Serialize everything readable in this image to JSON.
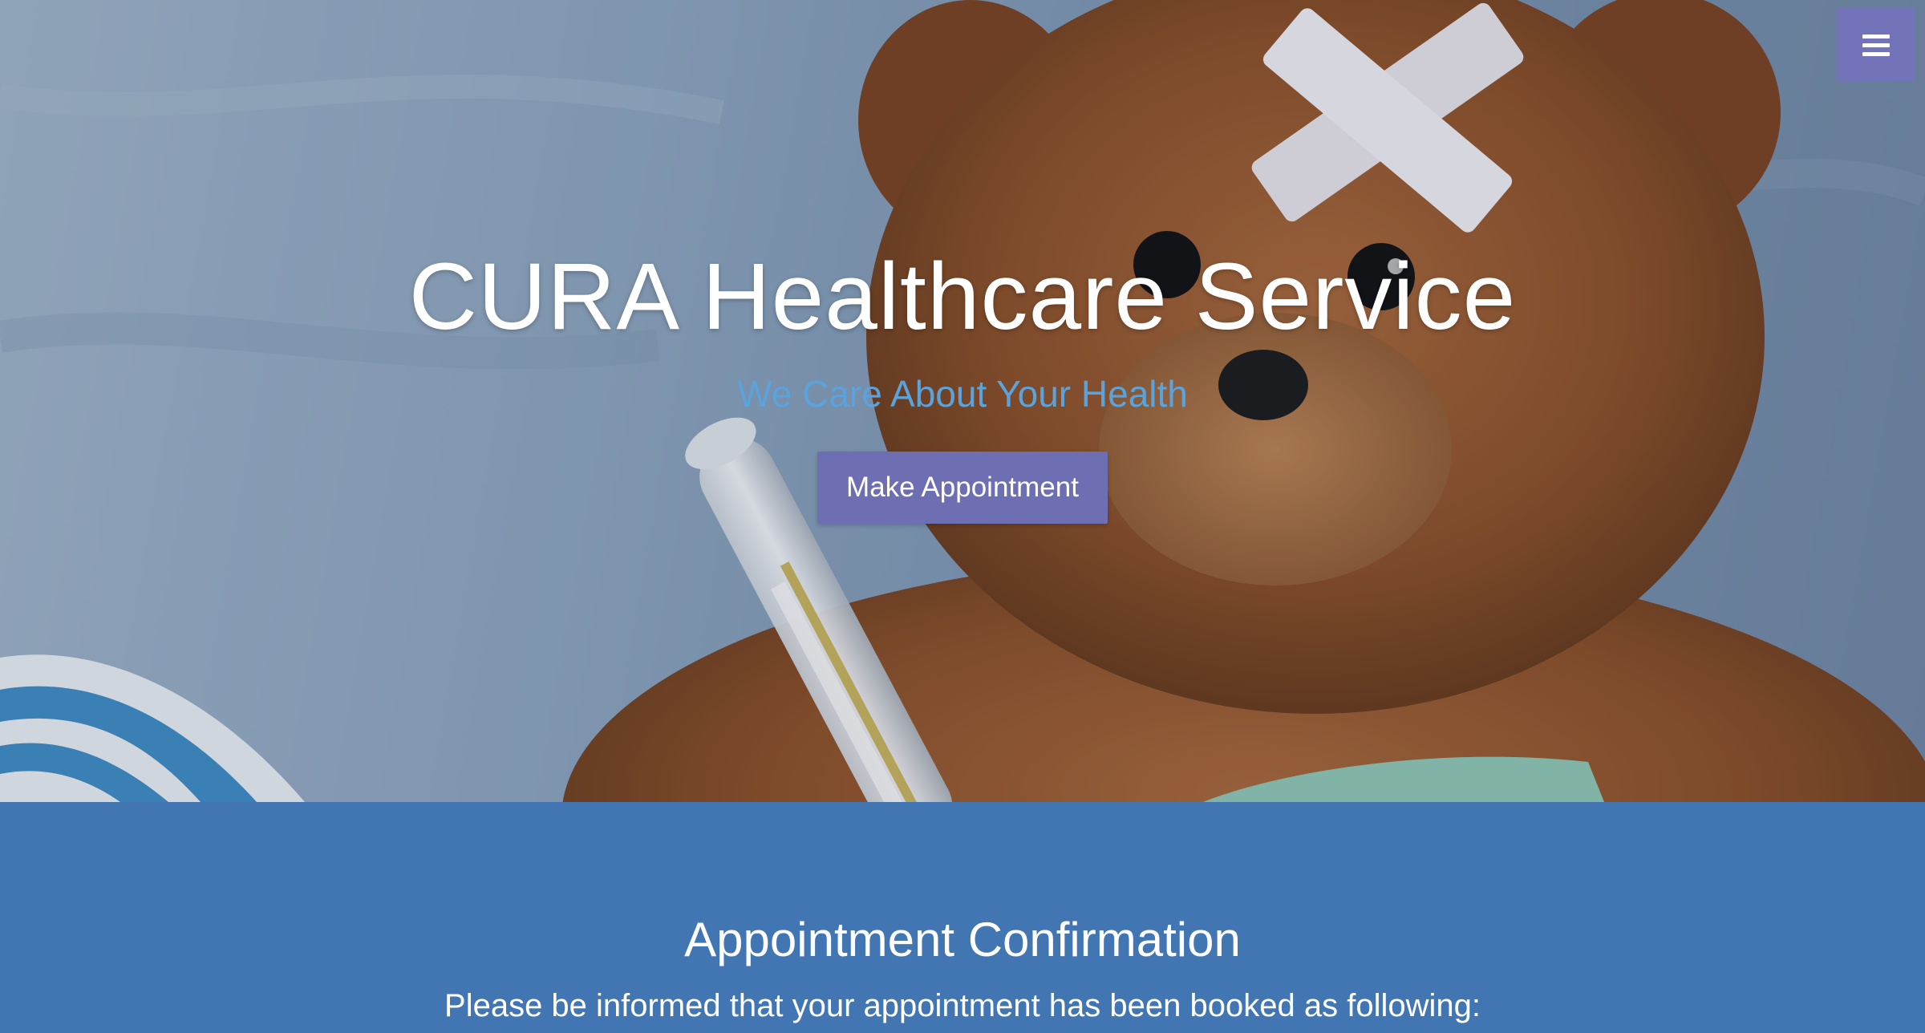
{
  "hero": {
    "title": "CURA Healthcare Service",
    "subtitle": "We Care About Your Health",
    "button_label": "Make Appointment",
    "background_image": "teddy bear with bandage and thermometer"
  },
  "menu": {
    "icon": "hamburger-menu-icon"
  },
  "confirmation": {
    "heading": "Appointment Confirmation",
    "message": "Please be informed that your appointment has been booked as following:"
  },
  "colors": {
    "accent": "#6e6fb3",
    "subtitle": "#5aa3dd",
    "section_bg": "#4176b3"
  }
}
